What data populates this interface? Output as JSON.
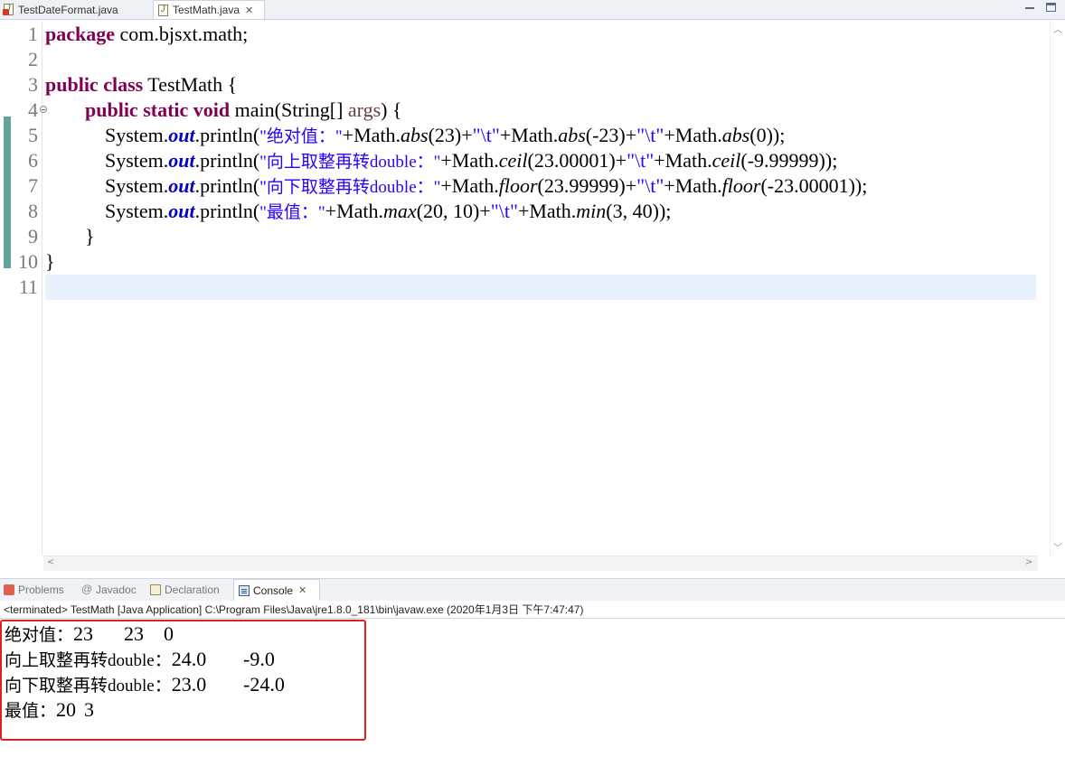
{
  "editor_tabs": [
    {
      "label": "TestDateFormat.java",
      "active": false,
      "has_error": true
    },
    {
      "label": "TestMath.java",
      "active": true,
      "close": "✕"
    }
  ],
  "line_numbers": [
    "1",
    "2",
    "3",
    "4",
    "5",
    "6",
    "7",
    "8",
    "9",
    "10",
    "11"
  ],
  "code": {
    "l1": {
      "kw": "package",
      "rest": " com.bjsxt.math;"
    },
    "l3": {
      "kw": "public class",
      "rest": " TestMath {"
    },
    "l4": {
      "indent": "        ",
      "kw": "public static void",
      "pre": " main(String[] ",
      "param": "args",
      "post": ") {"
    },
    "l5": {
      "indent": "            ",
      "a": "System.",
      "out": "out",
      "b": ".println(",
      "s1": "\"绝对值：\"",
      "c": "+Math.",
      "m1": "abs",
      "d": "(23)+",
      "s2": "\"\\t\"",
      "e": "+Math.",
      "m2": "abs",
      "f": "(-23)+",
      "s3": "\"\\t\"",
      "g": "+Math.",
      "m3": "abs",
      "h": "(0));"
    },
    "l6": {
      "indent": "            ",
      "a": "System.",
      "out": "out",
      "b": ".println(",
      "s1": "\"向上取整再转double：\"",
      "c": "+Math.",
      "m1": "ceil",
      "d": "(23.00001)+",
      "s2": "\"\\t\"",
      "e": "+Math.",
      "m2": "ceil",
      "f": "(-9.99999));"
    },
    "l7": {
      "indent": "            ",
      "a": "System.",
      "out": "out",
      "b": ".println(",
      "s1": "\"向下取整再转double：\"",
      "c": "+Math.",
      "m1": "floor",
      "d": "(23.99999)+",
      "s2": "\"\\t\"",
      "e": "+Math.",
      "m2": "floor",
      "f": "(-23.00001));"
    },
    "l8": {
      "indent": "            ",
      "a": "System.",
      "out": "out",
      "b": ".println(",
      "s1": "\"最值：\"",
      "c": "+Math.",
      "m1": "max",
      "d": "(20, 10)+",
      "s2": "\"\\t\"",
      "e": "+Math.",
      "m2": "min",
      "f": "(3, 40));"
    },
    "l9": "        }",
    "l10": "}"
  },
  "view_tabs": {
    "problems": "Problems",
    "javadoc": "Javadoc",
    "declaration": "Declaration",
    "console": "Console",
    "console_close": "✕"
  },
  "console_header": "<terminated> TestMath [Java Application] C:\\Program Files\\Java\\jre1.8.0_181\\bin\\javaw.exe (2020年1月3日 下午7:47:47)",
  "console_output": [
    {
      "label": "绝对值：",
      "values": "23\t23\t0"
    },
    {
      "label": "向上取整再转double：",
      "values": "24.0\t-9.0"
    },
    {
      "label": "向下取整再转double：",
      "values": "23.0\t-24.0"
    },
    {
      "label": "最值：",
      "values": "20\t3"
    }
  ],
  "colors": {
    "keyword": "#7f0055",
    "string": "#2a00ff",
    "field": "#0000c0",
    "highlight_box": "#e02020"
  }
}
